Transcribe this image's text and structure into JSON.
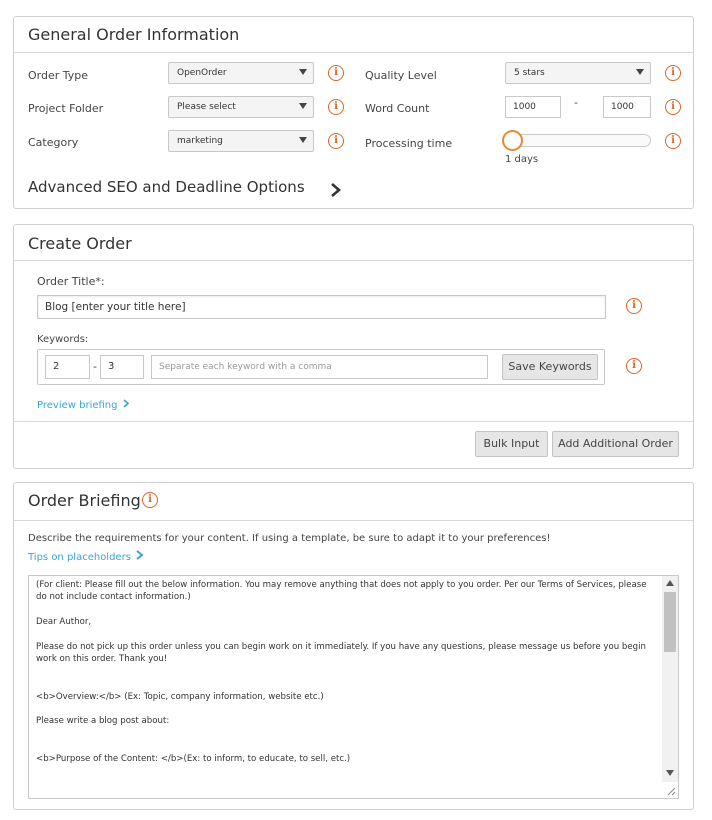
{
  "general": {
    "title": "General Order Information",
    "order_type_label": "Order Type",
    "order_type_value": "OpenOrder",
    "project_folder_label": "Project Folder",
    "project_folder_value": "Please select",
    "category_label": "Category",
    "category_value": "marketing",
    "quality_label": "Quality Level",
    "quality_value": "5 stars",
    "word_count_label": "Word Count",
    "word_count_min": "1000",
    "word_count_sep": "-",
    "word_count_max": "1000",
    "processing_label": "Processing time",
    "processing_value": "1 days",
    "processing_level": 0,
    "advanced_label": "Advanced SEO and Deadline Options",
    "info_glyph": "i"
  },
  "create": {
    "title": "Create Order",
    "order_title_label": "Order Title*:",
    "order_title_value": "Blog [enter your title here]",
    "keywords_label": "Keywords:",
    "kw_min": "2",
    "kw_sep": "-",
    "kw_max": "3",
    "kw_placeholder": "Separate each keyword with a comma",
    "save_keywords": "Save Keywords",
    "preview_briefing": "Preview briefing",
    "bulk_input": "Bulk Input",
    "add_additional": "Add Additional Order"
  },
  "briefing": {
    "title": "Order Briefing",
    "description": "Describe the requirements for your content. If using a template, be sure to adapt it to your preferences!",
    "tips_link": "Tips on placeholders",
    "text_lines": [
      "(For client: Please fill out the below information. You may remove anything that does not apply to you order. Per our Terms of Services, please",
      "do not include contact information.)",
      "",
      "Dear Author,",
      "",
      "Please do not pick up this order unless you can begin work on it immediately. If you have any questions, please message us before you begin",
      "work on this order. Thank you!",
      "",
      "",
      "<b>Overview:</b> (Ex: Topic, company information, website etc.)",
      "",
      "Please write a blog post about:",
      "",
      "",
      "<b>Purpose of the Content: </b>(Ex: to inform, to educate, to sell, etc.)"
    ]
  },
  "colors": {
    "accent_orange": "#d9652a",
    "link_blue": "#3aa3d6"
  }
}
